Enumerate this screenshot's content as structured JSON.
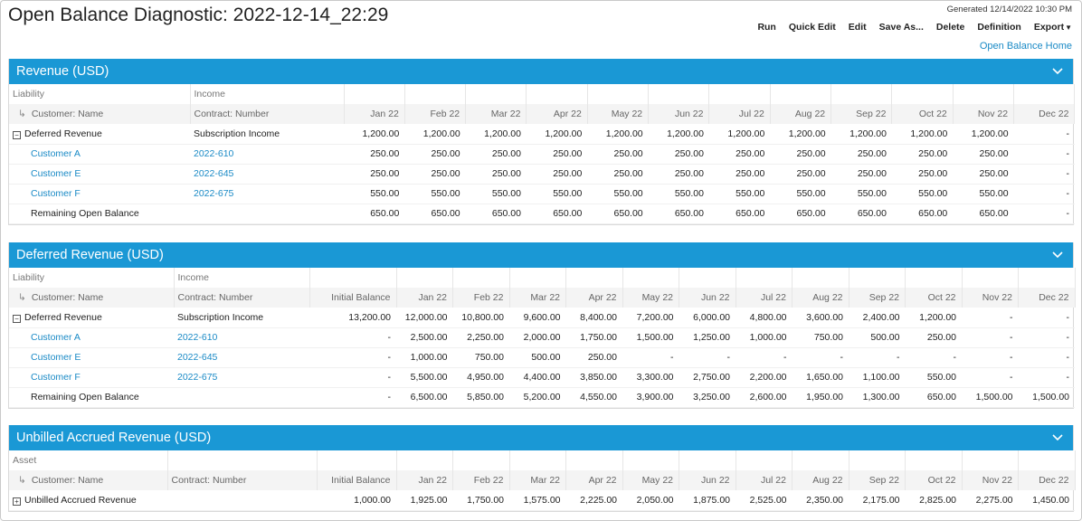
{
  "header": {
    "title": "Open Balance Diagnostic: 2022-12-14_22:29",
    "generated": "Generated 12/14/2022 10:30 PM",
    "toolbar": [
      "Run",
      "Quick Edit",
      "Edit",
      "Save As...",
      "Delete",
      "Definition",
      "Export"
    ],
    "home_link": "Open Balance Home"
  },
  "months": [
    "Jan 22",
    "Feb 22",
    "Mar 22",
    "Apr 22",
    "May 22",
    "Jun 22",
    "Jul 22",
    "Aug 22",
    "Sep 22",
    "Oct 22",
    "Nov 22",
    "Dec 22"
  ],
  "revenue": {
    "title": "Revenue (USD)",
    "h1": [
      "Liability",
      "Income"
    ],
    "h2": [
      "Customer: Name",
      "Contract: Number"
    ],
    "rows": [
      {
        "c1": "Deferred Revenue",
        "c2": "Subscription Income",
        "vals": [
          "1,200.00",
          "1,200.00",
          "1,200.00",
          "1,200.00",
          "1,200.00",
          "1,200.00",
          "1,200.00",
          "1,200.00",
          "1,200.00",
          "1,200.00",
          "1,200.00",
          "-"
        ]
      },
      {
        "c1": "Customer A",
        "c2": "2022-610",
        "vals": [
          "250.00",
          "250.00",
          "250.00",
          "250.00",
          "250.00",
          "250.00",
          "250.00",
          "250.00",
          "250.00",
          "250.00",
          "250.00",
          "-"
        ]
      },
      {
        "c1": "Customer E",
        "c2": "2022-645",
        "vals": [
          "250.00",
          "250.00",
          "250.00",
          "250.00",
          "250.00",
          "250.00",
          "250.00",
          "250.00",
          "250.00",
          "250.00",
          "250.00",
          "-"
        ]
      },
      {
        "c1": "Customer F",
        "c2": "2022-675",
        "vals": [
          "550.00",
          "550.00",
          "550.00",
          "550.00",
          "550.00",
          "550.00",
          "550.00",
          "550.00",
          "550.00",
          "550.00",
          "550.00",
          "-"
        ]
      },
      {
        "c1": "Remaining Open Balance",
        "c2": "",
        "vals": [
          "650.00",
          "650.00",
          "650.00",
          "650.00",
          "650.00",
          "650.00",
          "650.00",
          "650.00",
          "650.00",
          "650.00",
          "650.00",
          "-"
        ]
      }
    ]
  },
  "deferred": {
    "title": "Deferred Revenue (USD)",
    "h1": [
      "Liability",
      "Income"
    ],
    "h2": [
      "Customer: Name",
      "Contract: Number",
      "Initial Balance"
    ],
    "rows": [
      {
        "c1": "Deferred Revenue",
        "c2": "Subscription Income",
        "vals": [
          "13,200.00",
          "12,000.00",
          "10,800.00",
          "9,600.00",
          "8,400.00",
          "7,200.00",
          "6,000.00",
          "4,800.00",
          "3,600.00",
          "2,400.00",
          "1,200.00",
          "-",
          "-"
        ]
      },
      {
        "c1": "Customer A",
        "c2": "2022-610",
        "vals": [
          "-",
          "2,500.00",
          "2,250.00",
          "2,000.00",
          "1,750.00",
          "1,500.00",
          "1,250.00",
          "1,000.00",
          "750.00",
          "500.00",
          "250.00",
          "-",
          "-"
        ]
      },
      {
        "c1": "Customer E",
        "c2": "2022-645",
        "vals": [
          "-",
          "1,000.00",
          "750.00",
          "500.00",
          "250.00",
          "-",
          "-",
          "-",
          "-",
          "-",
          "-",
          "-",
          "-"
        ]
      },
      {
        "c1": "Customer F",
        "c2": "2022-675",
        "vals": [
          "-",
          "5,500.00",
          "4,950.00",
          "4,400.00",
          "3,850.00",
          "3,300.00",
          "2,750.00",
          "2,200.00",
          "1,650.00",
          "1,100.00",
          "550.00",
          "-",
          "-"
        ]
      },
      {
        "c1": "Remaining Open Balance",
        "c2": "",
        "vals": [
          "-",
          "6,500.00",
          "5,850.00",
          "5,200.00",
          "4,550.00",
          "3,900.00",
          "3,250.00",
          "2,600.00",
          "1,950.00",
          "1,300.00",
          "650.00",
          "1,500.00",
          "1,500.00"
        ]
      }
    ]
  },
  "unbilled": {
    "title": "Unbilled Accrued Revenue (USD)",
    "h1": [
      "Asset"
    ],
    "h2": [
      "Customer: Name",
      "Contract: Number",
      "Initial Balance"
    ],
    "rows": [
      {
        "c1": "Unbilled Accrued Revenue",
        "c2": "",
        "vals": [
          "1,000.00",
          "1,925.00",
          "1,750.00",
          "1,575.00",
          "2,225.00",
          "2,050.00",
          "1,875.00",
          "2,525.00",
          "2,350.00",
          "2,175.00",
          "2,825.00",
          "2,275.00",
          "1,450.00"
        ]
      }
    ]
  }
}
